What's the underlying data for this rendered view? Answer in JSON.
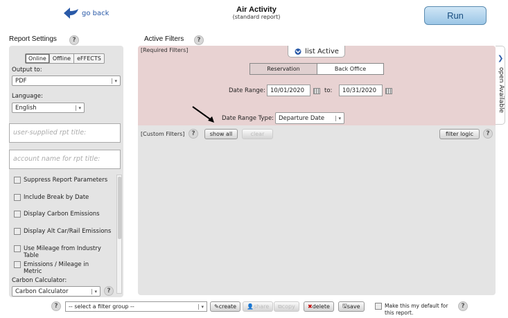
{
  "header": {
    "go_back": "go back",
    "title": "Air Activity",
    "subtitle": "(standard report)",
    "run": "Run"
  },
  "report_settings": {
    "heading": "Report Settings",
    "modes": [
      "Online",
      "Offline",
      "eFFECTS"
    ],
    "output_label": "Output to:",
    "output_value": "PDF",
    "language_label": "Language:",
    "language_value": "English",
    "rpt_title_placeholder": "user-supplied rpt title:",
    "account_placeholder": "account name for rpt title:",
    "options": [
      "Suppress Report Parameters",
      "Include Break by Date",
      "Display Carbon Emissions",
      "Display Alt Car/Rail Emissions",
      "Use Mileage from Industry Table",
      "Emissions / Mileage in Metric"
    ],
    "carbon_label": "Carbon Calculator:",
    "carbon_value": "Carbon Calculator"
  },
  "filters": {
    "heading": "Active Filters",
    "required_label": "[Required Filters]",
    "list_active": "list Active",
    "toggle": [
      "Reservation",
      "Back Office"
    ],
    "date_range_label": "Date Range:",
    "date_from": "10/01/2020",
    "to_label": "to:",
    "date_to": "10/31/2020",
    "date_type_label": "Date Range Type:",
    "date_type_value": "Departure Date",
    "custom_label": "[Custom Filters]",
    "show_all": "show all",
    "clear": "clear",
    "filter_logic": "filter logic",
    "side_tab": "open Available"
  },
  "bottom": {
    "filter_group": "-- select a filter group --",
    "create": "create",
    "share": "share",
    "copy": "copy",
    "delete": "delete",
    "save": "save",
    "default_label": "Make this my default for this report."
  },
  "colors": {
    "accent": "#2a5aa8",
    "required_bg": "#e8d2d2",
    "panel_bg": "#e4e4e4",
    "delete_red": "#c00000"
  }
}
